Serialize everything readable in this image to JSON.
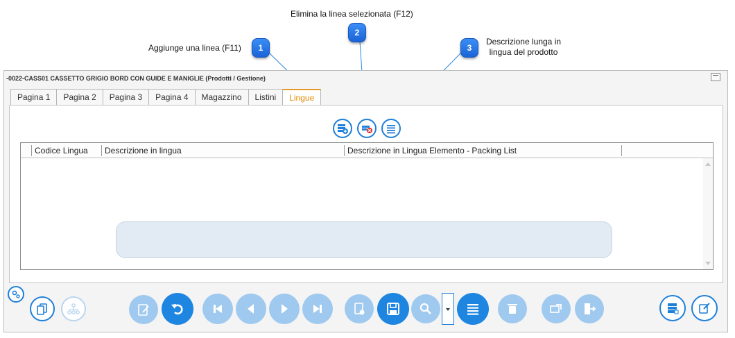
{
  "callouts": [
    {
      "number": "1",
      "text": "Aggiunge una linea (F11)"
    },
    {
      "number": "2",
      "text": "Elimina la linea selezionata (F12)"
    },
    {
      "number": "3",
      "text_line1": "Descrizione lunga in",
      "text_line2": "lingua del prodotto"
    }
  ],
  "window": {
    "title": "-0022-CASS01 CASSETTO GRIGIO BORD CON GUIDE E MANIGLIE (Prodotti / Gestione)"
  },
  "tabs": [
    {
      "label": "Pagina 1",
      "active": false
    },
    {
      "label": "Pagina 2",
      "active": false
    },
    {
      "label": "Pagina 3",
      "active": false
    },
    {
      "label": "Pagina 4",
      "active": false
    },
    {
      "label": "Magazzino",
      "active": false
    },
    {
      "label": "Listini",
      "active": false
    },
    {
      "label": "Lingue",
      "active": true
    }
  ],
  "panel_toolbar": {
    "buttons": [
      "add-row-icon",
      "delete-row-icon",
      "long-description-icon"
    ]
  },
  "grid": {
    "columns": [
      "Codice Lingua",
      "Descrizione in lingua",
      "Descrizione in Lingua Elemento - Packing List"
    ],
    "rows": []
  },
  "bottom_toolbar": {
    "left_buttons": [
      "settings-gear-icon",
      "copy-document-icon",
      "hierarchy-icon"
    ],
    "nav_buttons": [
      "edit-icon",
      "undo-icon",
      "first-record-icon",
      "previous-record-icon",
      "next-record-icon",
      "last-record-icon",
      "new-document-icon",
      "save-icon",
      "search-icon",
      "list-menu-icon",
      "delete-icon",
      "export-icon",
      "exit-icon"
    ],
    "right_buttons": [
      "table-icon",
      "edit-document-icon"
    ]
  },
  "colors": {
    "accent": "#1e86e0",
    "active_tab": "#e08a00",
    "badge": "#1a64d8"
  }
}
